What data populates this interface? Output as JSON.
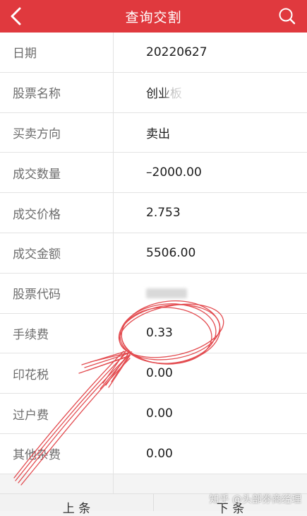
{
  "header": {
    "title": "查询交割",
    "back_icon": "chevron-left-icon",
    "search_icon": "search-icon",
    "background_color": "#e0393e"
  },
  "rows": [
    {
      "label": "日期",
      "value": "20220627"
    },
    {
      "label": "股票名称",
      "value": "创业板"
    },
    {
      "label": "买卖方向",
      "value": "卖出"
    },
    {
      "label": "成交数量",
      "value": "–2000.00"
    },
    {
      "label": "成交价格",
      "value": "2.753"
    },
    {
      "label": "成交金额",
      "value": "5506.00"
    },
    {
      "label": "股票代码",
      "value": ""
    },
    {
      "label": "手续费",
      "value": "0.33"
    },
    {
      "label": "印花税",
      "value": "0.00"
    },
    {
      "label": "过户费",
      "value": "0.00"
    },
    {
      "label": "其他杂费",
      "value": "0.00"
    }
  ],
  "footer": {
    "prev_label": "上 条",
    "next_label": "下 条"
  },
  "watermark": "知乎 @头部券商经理",
  "annotation_color": "#e0393e"
}
